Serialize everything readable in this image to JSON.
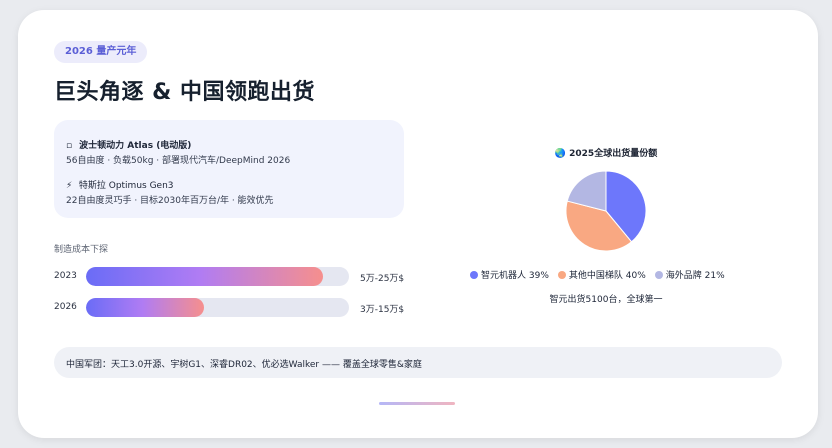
{
  "badge": "2026 量产元年",
  "title": "巨头角逐 & 中国领跑出货",
  "info": {
    "item1": {
      "icon": "robot-icon",
      "name": "波士顿动力 Atlas (电动版)",
      "desc": "56自由度 · 负载50kg · 部署现代汽车/DeepMind 2026"
    },
    "item2": {
      "icon": "lightning-icon",
      "icon_glyph": "⚡",
      "name": "特斯拉 Optimus Gen3",
      "desc": "22自由度灵巧手 · 目标2030年百万台/年 · 能效优先"
    }
  },
  "cost": {
    "label": "制造成本下探",
    "bars": [
      {
        "year": "2023",
        "value": "5万-25万$",
        "fill_ratio": 0.9
      },
      {
        "year": "2026",
        "value": "3万-15万$",
        "fill_ratio": 0.45
      }
    ]
  },
  "chart": {
    "icon": "globe-icon",
    "icon_glyph": "🌏",
    "title": "2025全球出货量份额",
    "note": "智元出货5100台，全球第一"
  },
  "chart_data": {
    "type": "pie",
    "title": "2025全球出货量份额",
    "categories": [
      "智元机器人",
      "其他中国梯队",
      "海外品牌"
    ],
    "values": [
      39,
      40,
      21
    ],
    "labels": [
      "智元机器人 39%",
      "其他中国梯队 40%",
      "海外品牌 21%"
    ],
    "colors": [
      "#6d77fb",
      "#f9a882",
      "#b3b7e3"
    ],
    "legend": "bottom"
  },
  "footer": {
    "text": "中国军团：天工3.0开源、宇树G1、深睿DR02、优必选Walker —— 覆盖全球零售&家庭"
  }
}
